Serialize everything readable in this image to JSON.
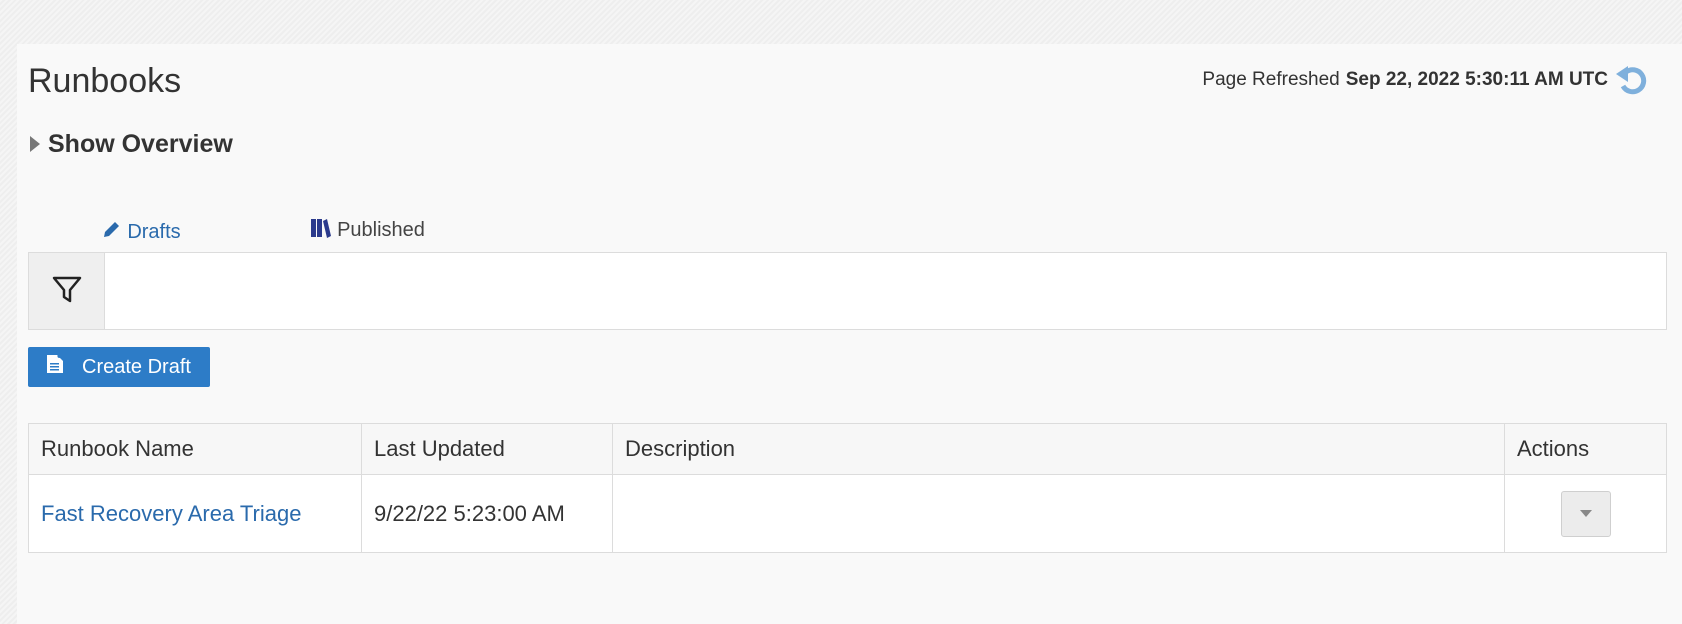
{
  "header": {
    "title": "Runbooks",
    "refresh_label": "Page Refreshed",
    "refresh_timestamp": "Sep 22, 2022 5:30:11 AM UTC"
  },
  "overview": {
    "label": "Show Overview"
  },
  "tabs": [
    {
      "label": "Drafts",
      "icon": "pencil-icon",
      "selected": true
    },
    {
      "label": "Published",
      "icon": "books-icon",
      "selected": false
    }
  ],
  "filter": {
    "icon": "filter-icon"
  },
  "create_button": {
    "label": "Create Draft",
    "icon": "new-document-icon"
  },
  "table": {
    "columns": [
      "Runbook Name",
      "Last Updated",
      "Description",
      "Actions"
    ],
    "rows": [
      {
        "name": "Fast Recovery Area Triage",
        "last_updated": "9/22/22 5:23:00 AM",
        "description": ""
      }
    ]
  },
  "colors": {
    "accent": "#2d7cc7",
    "link": "#2a6aac",
    "refresh_icon": "#7fb0dc"
  }
}
